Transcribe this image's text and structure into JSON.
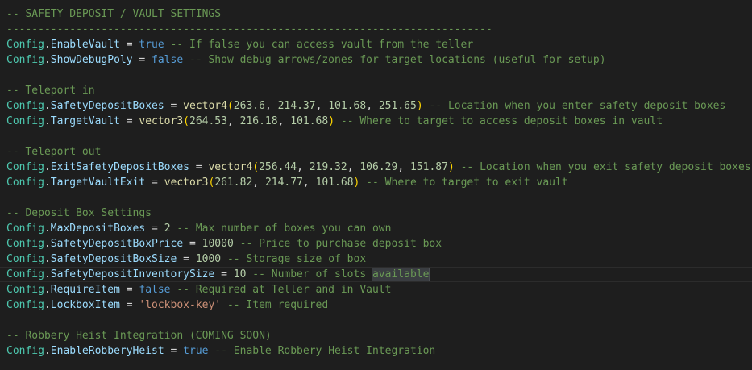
{
  "lines": [
    {
      "segments": [
        {
          "t": "-- SAFETY DEPOSIT / VAULT SETTINGS",
          "c": "comment"
        }
      ]
    },
    {
      "segments": [
        {
          "t": "-----------------------------------------------------------------------------",
          "c": "comment"
        }
      ]
    },
    {
      "segments": [
        {
          "t": "Config",
          "c": "class"
        },
        {
          "t": ".",
          "c": "op"
        },
        {
          "t": "EnableVault",
          "c": "prop"
        },
        {
          "t": " = ",
          "c": "op"
        },
        {
          "t": "true",
          "c": "bool"
        },
        {
          "t": " -- If false you can access vault from the teller",
          "c": "comment"
        }
      ]
    },
    {
      "segments": [
        {
          "t": "Config",
          "c": "class"
        },
        {
          "t": ".",
          "c": "op"
        },
        {
          "t": "ShowDebugPoly",
          "c": "prop"
        },
        {
          "t": " = ",
          "c": "op"
        },
        {
          "t": "false",
          "c": "bool"
        },
        {
          "t": " -- Show debug arrows/zones for target locations (useful for setup)",
          "c": "comment"
        }
      ]
    },
    {
      "segments": []
    },
    {
      "segments": [
        {
          "t": "-- Teleport in",
          "c": "comment"
        }
      ]
    },
    {
      "segments": [
        {
          "t": "Config",
          "c": "class"
        },
        {
          "t": ".",
          "c": "op"
        },
        {
          "t": "SafetyDepositBoxes",
          "c": "prop"
        },
        {
          "t": " = ",
          "c": "op"
        },
        {
          "t": "vector4",
          "c": "func"
        },
        {
          "t": "(",
          "c": "paren"
        },
        {
          "t": "263.6",
          "c": "num"
        },
        {
          "t": ", ",
          "c": "op"
        },
        {
          "t": "214.37",
          "c": "num"
        },
        {
          "t": ", ",
          "c": "op"
        },
        {
          "t": "101.68",
          "c": "num"
        },
        {
          "t": ", ",
          "c": "op"
        },
        {
          "t": "251.65",
          "c": "num"
        },
        {
          "t": ")",
          "c": "paren"
        },
        {
          "t": " -- Location when you enter safety deposit boxes",
          "c": "comment"
        }
      ]
    },
    {
      "segments": [
        {
          "t": "Config",
          "c": "class"
        },
        {
          "t": ".",
          "c": "op"
        },
        {
          "t": "TargetVault",
          "c": "prop"
        },
        {
          "t": " = ",
          "c": "op"
        },
        {
          "t": "vector3",
          "c": "func"
        },
        {
          "t": "(",
          "c": "paren"
        },
        {
          "t": "264.53",
          "c": "num"
        },
        {
          "t": ", ",
          "c": "op"
        },
        {
          "t": "216.18",
          "c": "num"
        },
        {
          "t": ", ",
          "c": "op"
        },
        {
          "t": "101.68",
          "c": "num"
        },
        {
          "t": ")",
          "c": "paren"
        },
        {
          "t": " -- Where to target to access deposit boxes in vault",
          "c": "comment"
        }
      ]
    },
    {
      "segments": []
    },
    {
      "segments": [
        {
          "t": "-- Teleport out",
          "c": "comment"
        }
      ]
    },
    {
      "segments": [
        {
          "t": "Config",
          "c": "class"
        },
        {
          "t": ".",
          "c": "op"
        },
        {
          "t": "ExitSafetyDepositBoxes",
          "c": "prop"
        },
        {
          "t": " = ",
          "c": "op"
        },
        {
          "t": "vector4",
          "c": "func"
        },
        {
          "t": "(",
          "c": "paren"
        },
        {
          "t": "256.44",
          "c": "num"
        },
        {
          "t": ", ",
          "c": "op"
        },
        {
          "t": "219.32",
          "c": "num"
        },
        {
          "t": ", ",
          "c": "op"
        },
        {
          "t": "106.29",
          "c": "num"
        },
        {
          "t": ", ",
          "c": "op"
        },
        {
          "t": "151.87",
          "c": "num"
        },
        {
          "t": ")",
          "c": "paren"
        },
        {
          "t": " -- Location when you exit safety deposit boxes",
          "c": "comment"
        }
      ]
    },
    {
      "segments": [
        {
          "t": "Config",
          "c": "class"
        },
        {
          "t": ".",
          "c": "op"
        },
        {
          "t": "TargetVaultExit",
          "c": "prop"
        },
        {
          "t": " = ",
          "c": "op"
        },
        {
          "t": "vector3",
          "c": "func"
        },
        {
          "t": "(",
          "c": "paren"
        },
        {
          "t": "261.82",
          "c": "num"
        },
        {
          "t": ", ",
          "c": "op"
        },
        {
          "t": "214.77",
          "c": "num"
        },
        {
          "t": ", ",
          "c": "op"
        },
        {
          "t": "101.68",
          "c": "num"
        },
        {
          "t": ")",
          "c": "paren"
        },
        {
          "t": " -- Where to target to exit vault",
          "c": "comment"
        }
      ]
    },
    {
      "segments": []
    },
    {
      "segments": [
        {
          "t": "-- Deposit Box Settings",
          "c": "comment"
        }
      ]
    },
    {
      "segments": [
        {
          "t": "Config",
          "c": "class"
        },
        {
          "t": ".",
          "c": "op"
        },
        {
          "t": "MaxDepositBoxes",
          "c": "prop"
        },
        {
          "t": " = ",
          "c": "op"
        },
        {
          "t": "2",
          "c": "num"
        },
        {
          "t": " -- Max number of boxes you can own",
          "c": "comment"
        }
      ]
    },
    {
      "segments": [
        {
          "t": "Config",
          "c": "class"
        },
        {
          "t": ".",
          "c": "op"
        },
        {
          "t": "SafetyDepositBoxPrice",
          "c": "prop"
        },
        {
          "t": " = ",
          "c": "op"
        },
        {
          "t": "10000",
          "c": "num"
        },
        {
          "t": " -- Price to purchase deposit box",
          "c": "comment"
        }
      ]
    },
    {
      "segments": [
        {
          "t": "Config",
          "c": "class"
        },
        {
          "t": ".",
          "c": "op"
        },
        {
          "t": "SafetyDepositBoxSize",
          "c": "prop"
        },
        {
          "t": " = ",
          "c": "op"
        },
        {
          "t": "1000",
          "c": "num"
        },
        {
          "t": " -- Storage size of box",
          "c": "comment"
        }
      ]
    },
    {
      "current": true,
      "segments": [
        {
          "t": "Config",
          "c": "class"
        },
        {
          "t": ".",
          "c": "op"
        },
        {
          "t": "SafetyDepositInventorySize",
          "c": "prop"
        },
        {
          "t": " = ",
          "c": "op"
        },
        {
          "t": "10",
          "c": "num"
        },
        {
          "t": " -- Number of slots ",
          "c": "comment"
        },
        {
          "t": "available",
          "c": "comment",
          "hl": true
        }
      ]
    },
    {
      "segments": [
        {
          "t": "Config",
          "c": "class"
        },
        {
          "t": ".",
          "c": "op"
        },
        {
          "t": "RequireItem",
          "c": "prop"
        },
        {
          "t": " = ",
          "c": "op"
        },
        {
          "t": "false",
          "c": "bool"
        },
        {
          "t": " -- Required at Teller and in Vault",
          "c": "comment"
        }
      ]
    },
    {
      "segments": [
        {
          "t": "Config",
          "c": "class"
        },
        {
          "t": ".",
          "c": "op"
        },
        {
          "t": "LockboxItem",
          "c": "prop"
        },
        {
          "t": " = ",
          "c": "op"
        },
        {
          "t": "'lockbox-key'",
          "c": "str"
        },
        {
          "t": " -- Item required",
          "c": "comment"
        }
      ]
    },
    {
      "segments": []
    },
    {
      "segments": [
        {
          "t": "-- Robbery Heist Integration (COMING SOON)",
          "c": "comment"
        }
      ]
    },
    {
      "segments": [
        {
          "t": "Config",
          "c": "class"
        },
        {
          "t": ".",
          "c": "op"
        },
        {
          "t": "EnableRobberyHeist",
          "c": "prop"
        },
        {
          "t": " = ",
          "c": "op"
        },
        {
          "t": "true",
          "c": "bool"
        },
        {
          "t": " -- Enable Robbery Heist Integration",
          "c": "comment"
        }
      ]
    }
  ],
  "colors": {
    "background": "#1e1e1e",
    "comment": "#6a9955",
    "class": "#4ec9b0",
    "property": "#9cdcfe",
    "boolean": "#569cd6",
    "function": "#dcdcaa",
    "number": "#b5cea8",
    "string": "#ce9178",
    "bracket": "#ffd700"
  }
}
